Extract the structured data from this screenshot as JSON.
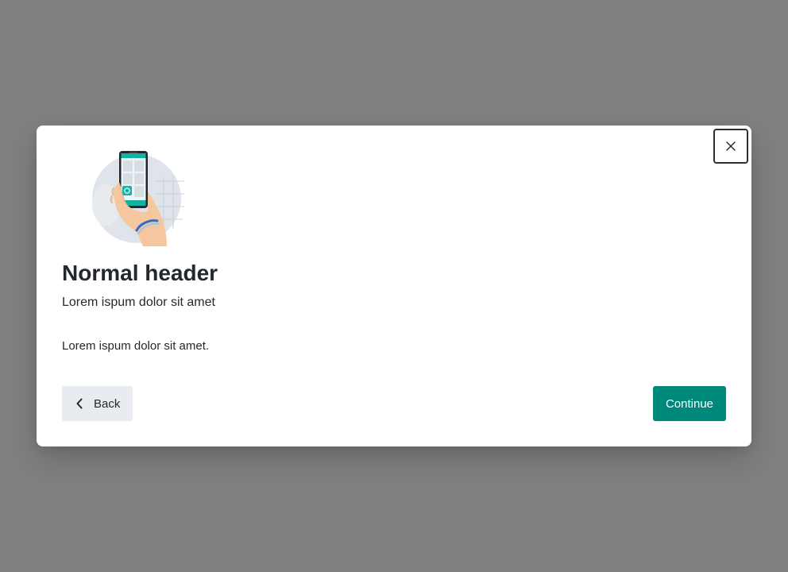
{
  "modal": {
    "close_icon": "close-icon",
    "illustration_icon": "hand-holding-phone-icon",
    "title": "Normal header",
    "subtitle": "Lorem ispum dolor sit amet",
    "body": "Lorem ispum dolor sit amet.",
    "back_label": "Back",
    "back_icon": "chevron-left-icon",
    "continue_label": "Continue"
  },
  "colors": {
    "backdrop": "#808080",
    "primary": "#00897b",
    "secondary_button": "#e8ebef",
    "text": "#23282f"
  }
}
